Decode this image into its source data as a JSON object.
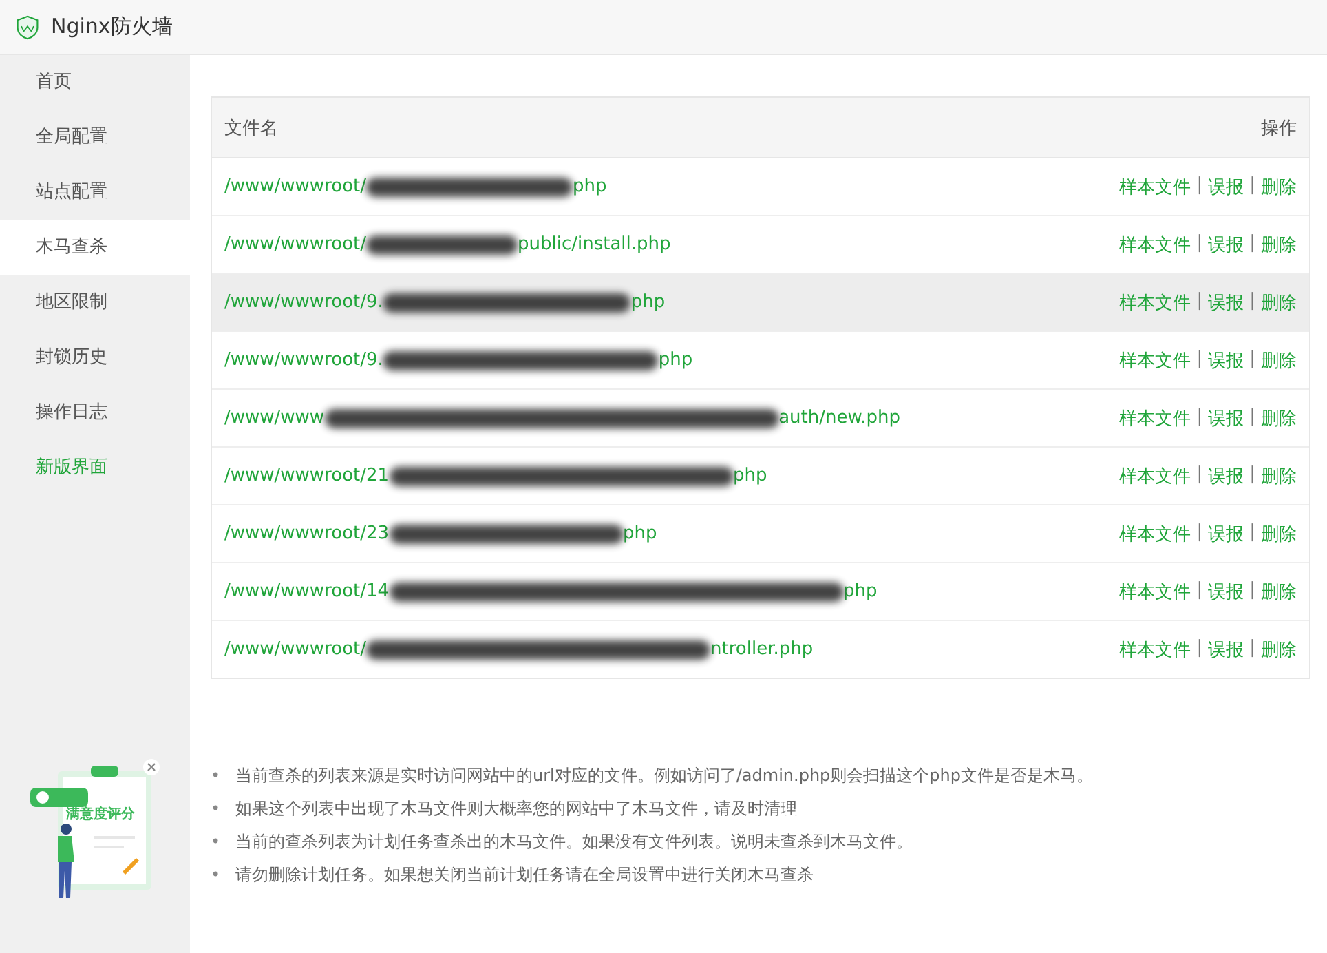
{
  "window": {
    "title": "Nginx防火墙"
  },
  "sidebar": {
    "items": [
      {
        "label": "首页",
        "selected": false,
        "kind": "normal"
      },
      {
        "label": "全局配置",
        "selected": false,
        "kind": "normal"
      },
      {
        "label": "站点配置",
        "selected": false,
        "kind": "normal"
      },
      {
        "label": "木马查杀",
        "selected": true,
        "kind": "normal"
      },
      {
        "label": "地区限制",
        "selected": false,
        "kind": "normal"
      },
      {
        "label": "封锁历史",
        "selected": false,
        "kind": "normal"
      },
      {
        "label": "操作日志",
        "selected": false,
        "kind": "normal"
      },
      {
        "label": "新版界面",
        "selected": false,
        "kind": "accent"
      }
    ]
  },
  "table": {
    "columns": [
      "文件名",
      "操作"
    ],
    "rows": [
      {
        "path_start": "/www/wwwroot/",
        "path_end": "php",
        "highlighted": false,
        "separator": "|",
        "actions": [
          "样本文件",
          "误报",
          "删除"
        ]
      },
      {
        "path_start": "/www/wwwroot/",
        "path_end": "public/install.php",
        "highlighted": false,
        "separator": "|",
        "actions": [
          "样本文件",
          "误报",
          "删除"
        ]
      },
      {
        "path_start": "/www/wwwroot/9.",
        "path_end": "php",
        "highlighted": true,
        "separator": "|",
        "actions": [
          "样本文件",
          "误报",
          "删除"
        ]
      },
      {
        "path_start": "/www/wwwroot/9.",
        "path_end": "php",
        "highlighted": false,
        "separator": "|",
        "actions": [
          "样本文件",
          "误报",
          "删除"
        ]
      },
      {
        "path_start": "/www/www",
        "path_end": "auth/new.php",
        "highlighted": false,
        "separator": "|",
        "actions": [
          "样本文件",
          "误报",
          "删除"
        ]
      },
      {
        "path_start": "/www/wwwroot/21",
        "path_end": "php",
        "highlighted": false,
        "separator": "|",
        "actions": [
          "样本文件",
          "误报",
          "删除"
        ]
      },
      {
        "path_start": "/www/wwwroot/23",
        "path_end": "php",
        "highlighted": false,
        "separator": "|",
        "actions": [
          "样本文件",
          "误报",
          "删除"
        ]
      },
      {
        "path_start": "/www/wwwroot/14",
        "path_end": "php",
        "highlighted": false,
        "separator": "|",
        "actions": [
          "样本文件",
          "误报",
          "删除"
        ]
      },
      {
        "path_start": "/www/wwwroot/",
        "path_end": "ntroller.php",
        "highlighted": false,
        "separator": "|",
        "actions": [
          "样本文件",
          "误报",
          "删除"
        ]
      }
    ]
  },
  "survey": {
    "label": "满意度评分"
  },
  "notes": [
    {
      "bullet": "•",
      "text": "当前查杀的列表来源是实时访问网站中的url对应的文件。例如访问了/admin.php则会扫描这个php文件是否是木马。"
    },
    {
      "bullet": "•",
      "text": "如果这个列表中出现了木马文件则大概率您的网站中了木马文件，请及时清理"
    },
    {
      "bullet": "•",
      "text": "当前的查杀列表为计划任务查杀出的木马文件。如果没有文件列表。说明未查杀到木马文件。"
    },
    {
      "bullet": "•",
      "text": "请勿删除计划任务。如果想关闭当前计划任务请在全局设置中进行关闭木马查杀"
    }
  ]
}
